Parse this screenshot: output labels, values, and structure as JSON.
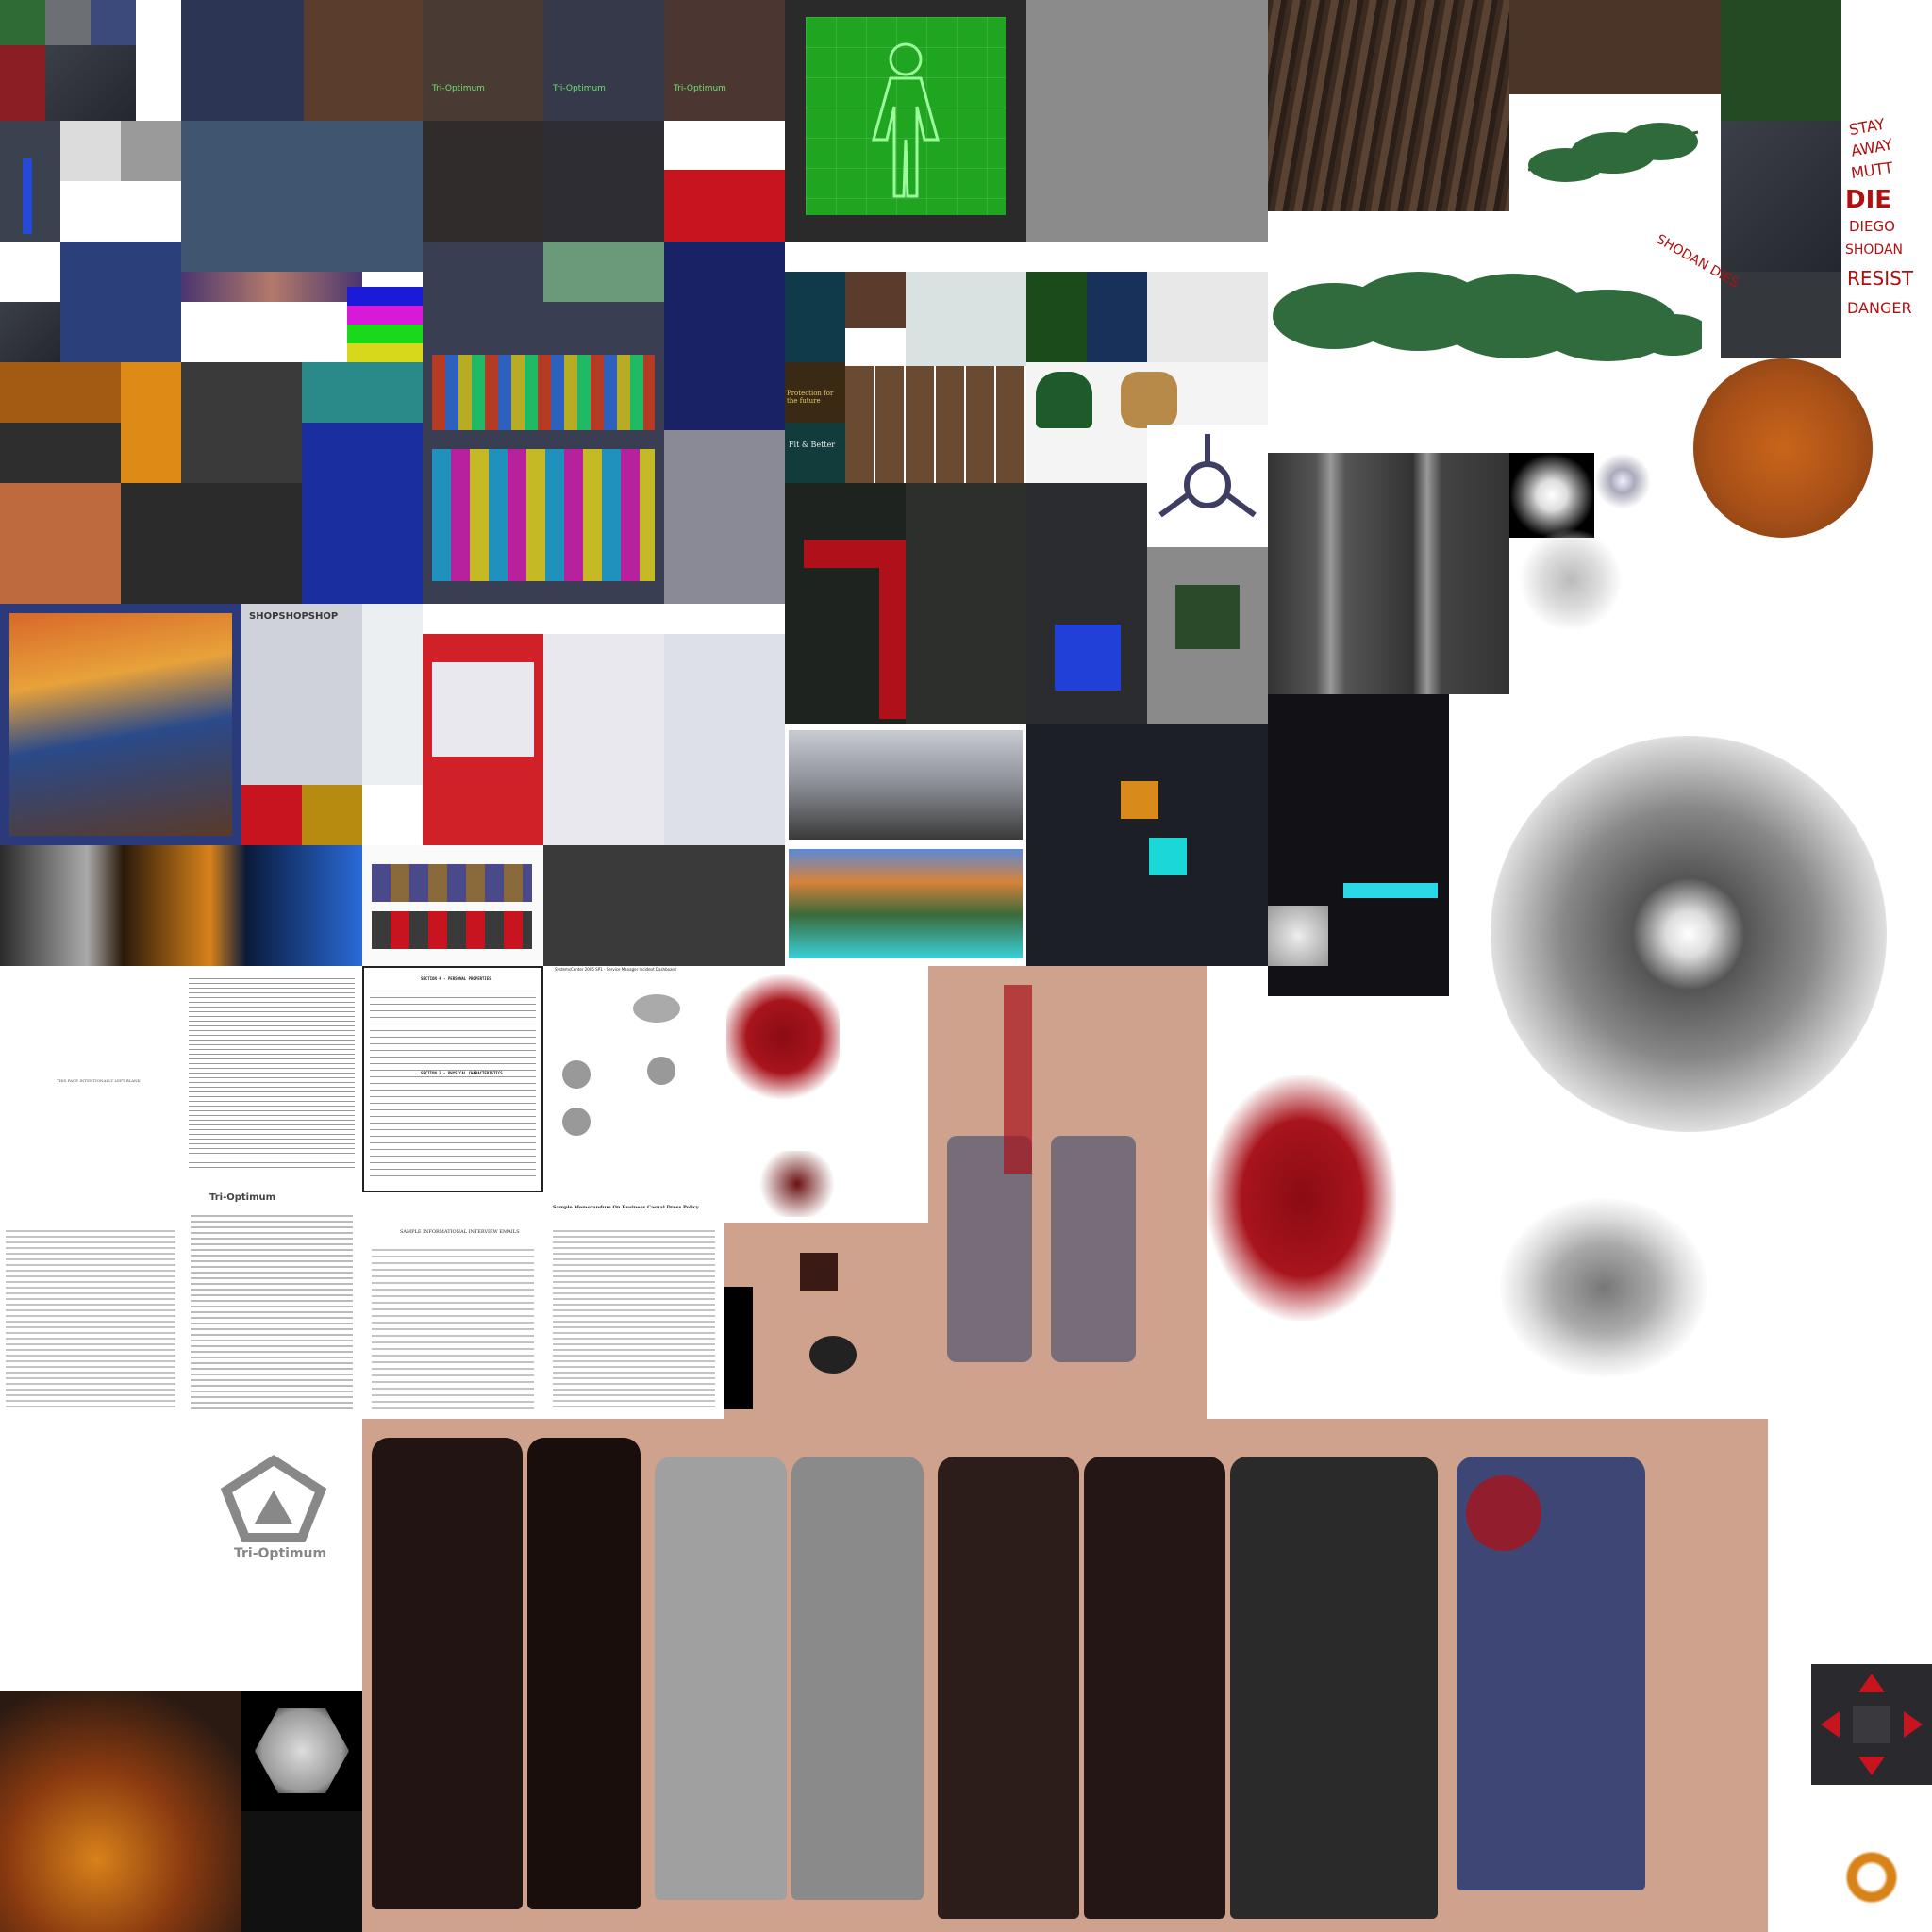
{
  "atlas": {
    "labels": {
      "tri_optimum_top1": "Tri-Optimum",
      "tri_optimum_top2": "Tri-Optimum",
      "tri_optimum_top3": "Tri-Optimum",
      "tri_optimum_logo": "Tri-Optimum",
      "tri_optimum_doc": "Tri-Optimum",
      "shop_sign": "SHOPSHOPSHOP",
      "protection_sign": "Protection for the future",
      "better_sign": "Fit & Better",
      "document_blank": "THIS PAGE INTENTIONALLY LEFT BLANK",
      "interview_title": "SAMPLE INFORMATIONAL INTERVIEW EMAILS",
      "memo_title": "Sample Memorandum On Business Casual Dress Policy",
      "dashboard_title": "SystemsCenter 2005 SP1 - Service Manager Incident Dashboard",
      "section_title": "SECTION 4 - PERSONAL PROPERTIES",
      "stock_title": "SECTION 2 - PHYSICAL CHARACTERISTICS"
    },
    "graffiti": [
      "STAY",
      "AWAY",
      "MUTT",
      "DIE",
      "DIEGO",
      "SHODAN",
      "RESIST",
      "DANGER"
    ],
    "graffiti_small": [
      "SHODAN",
      "DIES"
    ],
    "colors": {
      "bg": "#ffffff",
      "skin": "#cfa28d",
      "blood": "#8b0b14",
      "green_screen": "#1fa51f",
      "dark_panel": "#2b2e33"
    }
  }
}
